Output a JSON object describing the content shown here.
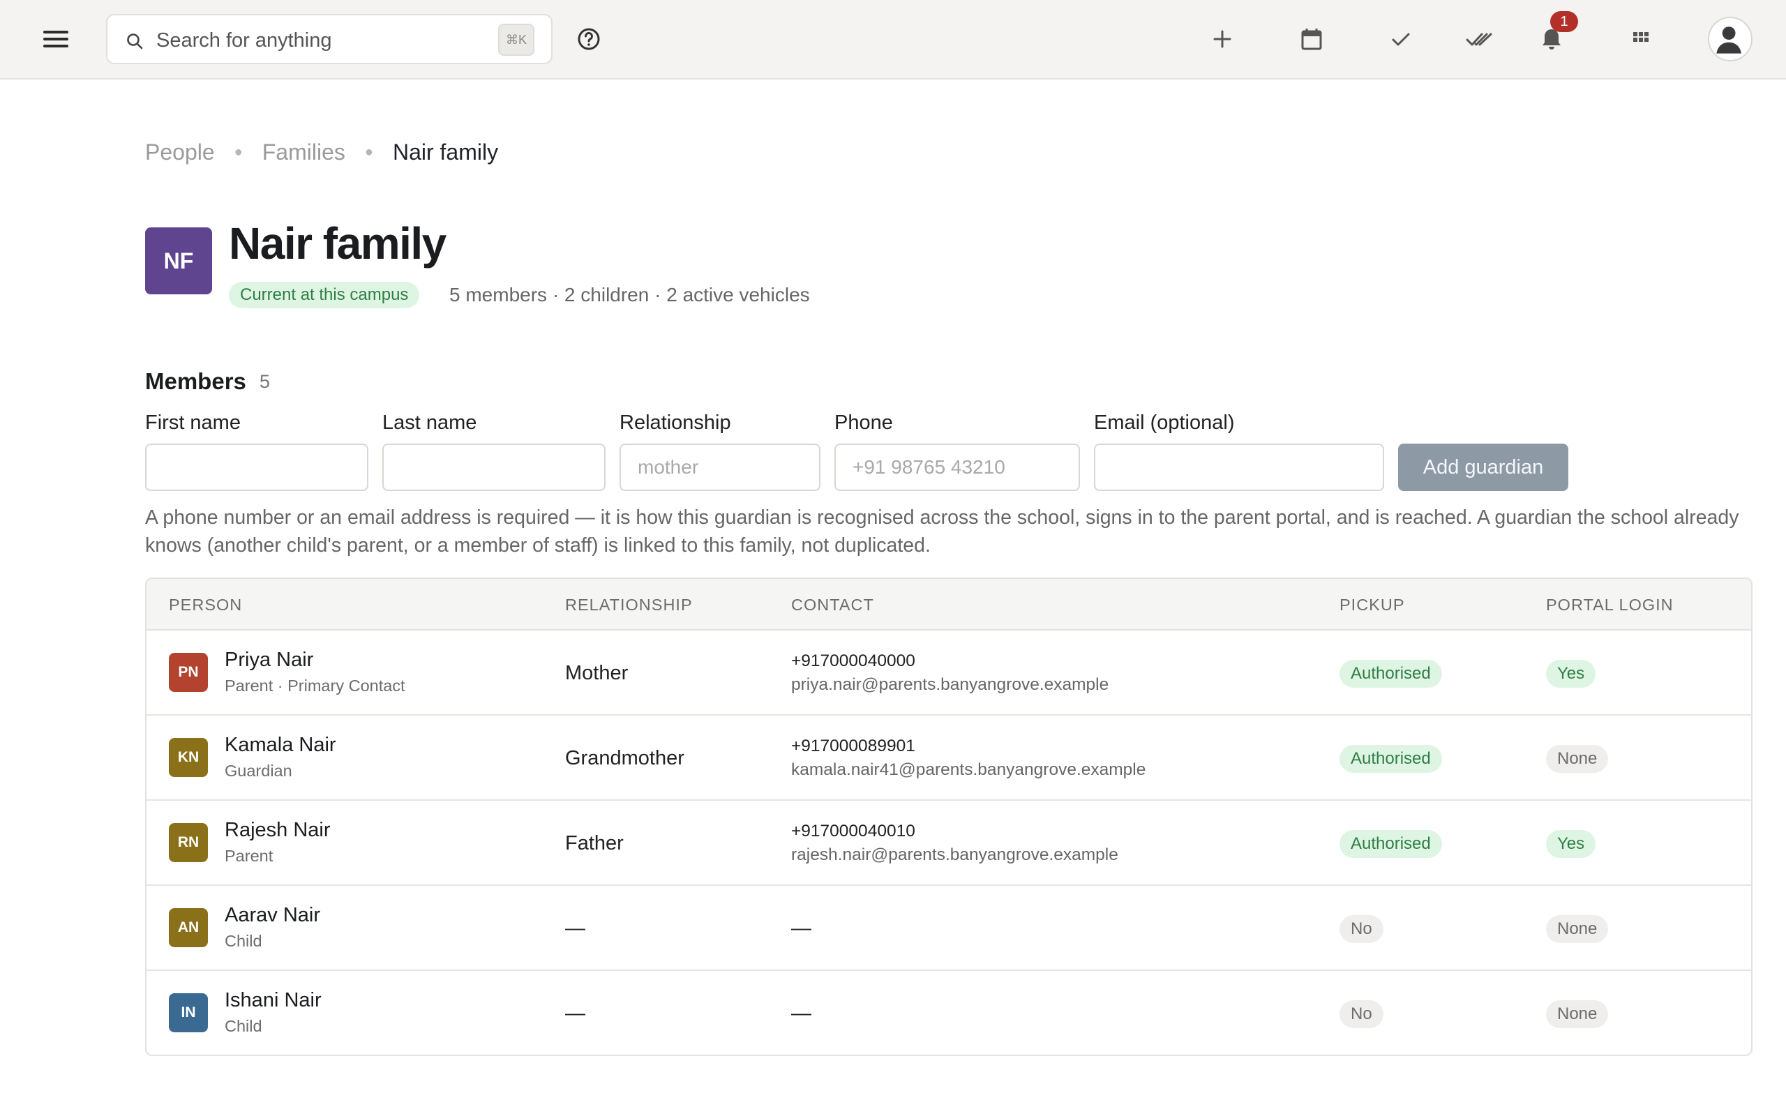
{
  "topbar": {
    "search_placeholder": "Search for anything",
    "search_shortcut": "⌘K",
    "notifications_count": "1"
  },
  "breadcrumb": {
    "items": [
      "People",
      "Families"
    ],
    "current": "Nair family"
  },
  "family": {
    "initials": "NF",
    "name": "Nair family",
    "status": "Current at this campus",
    "meta": "5 members · 2 children · 2 active vehicles",
    "avatar_color": "#5f4590"
  },
  "members": {
    "heading": "Members",
    "count": "5"
  },
  "form": {
    "first_name_label": "First name",
    "last_name_label": "Last name",
    "relationship_label": "Relationship",
    "relationship_placeholder": "mother",
    "phone_label": "Phone",
    "phone_placeholder": "+91 98765 43210",
    "email_label": "Email (optional)",
    "submit_label": "Add guardian",
    "help_text": "A phone number or an email address is required — it is how this guardian is recognised across the school, signs in to the parent portal, and is reached. A guardian the school already knows (another child's parent, or a member of staff) is linked to this family, not duplicated."
  },
  "table": {
    "columns": [
      "PERSON",
      "RELATIONSHIP",
      "CONTACT",
      "PICKUP",
      "PORTAL LOGIN"
    ],
    "rows": [
      {
        "initials": "PN",
        "name": "Priya Nair",
        "role": "Parent · Primary Contact",
        "relationship": "Mother",
        "phone": "+917000040000",
        "email": "priya.nair@parents.banyangrove.example",
        "pickup": "Authorised",
        "portal": "Yes",
        "avatar_color": "#b3432f"
      },
      {
        "initials": "KN",
        "name": "Kamala Nair",
        "role": "Guardian",
        "relationship": "Grandmother",
        "phone": "+917000089901",
        "email": "kamala.nair41@parents.banyangrove.example",
        "pickup": "Authorised",
        "portal": "None",
        "avatar_color": "#8a7018"
      },
      {
        "initials": "RN",
        "name": "Rajesh Nair",
        "role": "Parent",
        "relationship": "Father",
        "phone": "+917000040010",
        "email": "rajesh.nair@parents.banyangrove.example",
        "pickup": "Authorised",
        "portal": "Yes",
        "avatar_color": "#8a7018"
      },
      {
        "initials": "AN",
        "name": "Aarav Nair",
        "role": "Child",
        "relationship": "—",
        "contact": "—",
        "pickup": "No",
        "portal": "None",
        "avatar_color": "#8a7018"
      },
      {
        "initials": "IN",
        "name": "Ishani Nair",
        "role": "Child",
        "relationship": "—",
        "contact": "—",
        "pickup": "No",
        "portal": "None",
        "avatar_color": "#3a6a92"
      }
    ]
  },
  "colors": {
    "topbar_bg": "#f4f3f1",
    "success_bg": "#dff5e3",
    "success_text": "#2f7d45",
    "notification_badge": "#b3302a",
    "button_disabled": "#8e99a6"
  }
}
